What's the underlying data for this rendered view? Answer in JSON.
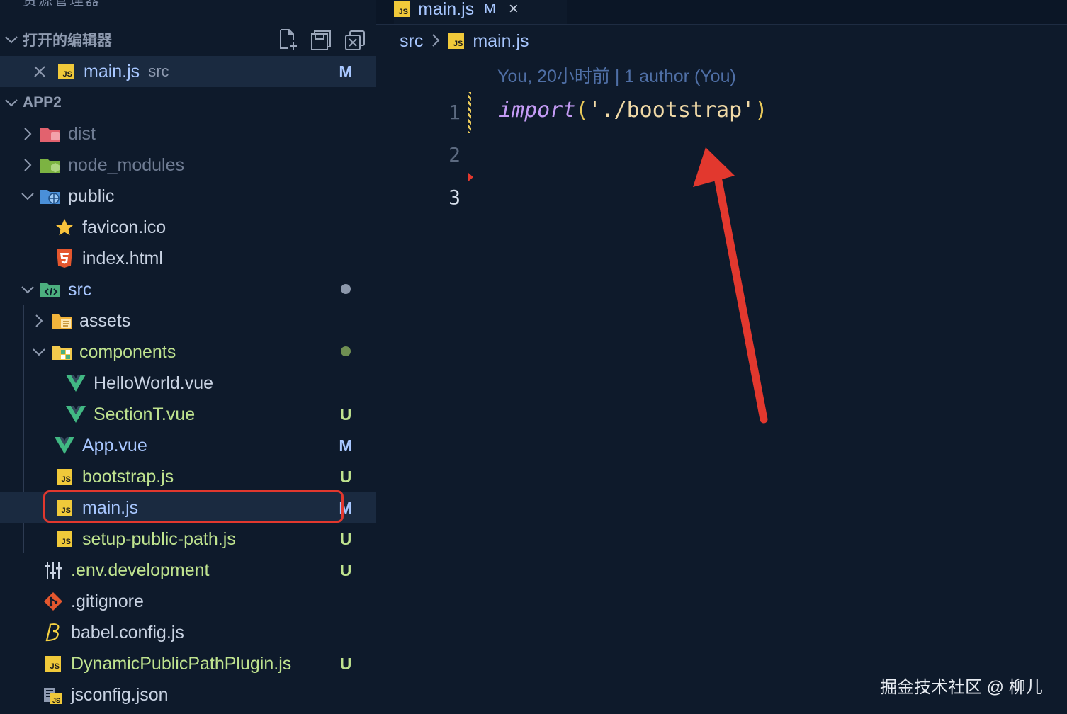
{
  "sidebar": {
    "title": "资源管理器",
    "more": "···",
    "open_editors": {
      "header": "打开的编辑器",
      "items": [
        {
          "icon": "js-icon",
          "label": "main.js",
          "sub": "src",
          "badge": "M"
        }
      ]
    },
    "project": {
      "header": "APP2",
      "items": [
        {
          "icon": "dist-folder-icon",
          "label": "dist",
          "expanded": false
        },
        {
          "icon": "node-modules-folder-icon",
          "label": "node_modules",
          "expanded": false
        },
        {
          "icon": "public-folder-icon",
          "label": "public",
          "expanded": true
        },
        {
          "icon": "star-icon",
          "label": "favicon.ico"
        },
        {
          "icon": "html5-icon",
          "label": "index.html"
        },
        {
          "icon": "src-folder-icon",
          "label": "src",
          "expanded": true,
          "dot": "modified"
        },
        {
          "icon": "assets-folder-icon",
          "label": "assets",
          "expanded": false
        },
        {
          "icon": "components-folder-icon",
          "label": "components",
          "expanded": true,
          "dot": "untracked"
        },
        {
          "icon": "vue-icon",
          "label": "HelloWorld.vue"
        },
        {
          "icon": "vue-icon",
          "label": "SectionT.vue",
          "badge": "U"
        },
        {
          "icon": "vue-icon",
          "label": "App.vue",
          "badge": "M"
        },
        {
          "icon": "js-icon",
          "label": "bootstrap.js",
          "badge": "U"
        },
        {
          "icon": "js-icon",
          "label": "main.js",
          "badge": "M",
          "selected": true
        },
        {
          "icon": "js-icon",
          "label": "setup-public-path.js",
          "badge": "U"
        },
        {
          "icon": "env-settings-icon",
          "label": ".env.development",
          "badge": "U"
        },
        {
          "icon": "git-icon",
          "label": ".gitignore"
        },
        {
          "icon": "babel-icon",
          "label": "babel.config.js"
        },
        {
          "icon": "js-icon",
          "label": "DynamicPublicPathPlugin.js",
          "badge": "U"
        },
        {
          "icon": "jsconfig-icon",
          "label": "jsconfig.json"
        }
      ]
    }
  },
  "editor": {
    "tab": {
      "label": "main.js",
      "mark": "M",
      "close": "×"
    },
    "breadcrumb": {
      "folder": "src",
      "file": "main.js"
    },
    "codelens": "You, 20小时前 | 1 author (You)",
    "lines": [
      "1",
      "2",
      "3"
    ],
    "code": {
      "keyword": "import",
      "open": "(",
      "string": "'./bootstrap'",
      "close": ")"
    }
  },
  "watermark": "掘金技术社区 @ 柳儿",
  "colors": {
    "background": "#0e1a2b",
    "modified": "#a8c7ff",
    "untracked": "#bfe38f",
    "highlight": "#e2382e",
    "js": "#f0c93a",
    "vue": "#41b883"
  }
}
